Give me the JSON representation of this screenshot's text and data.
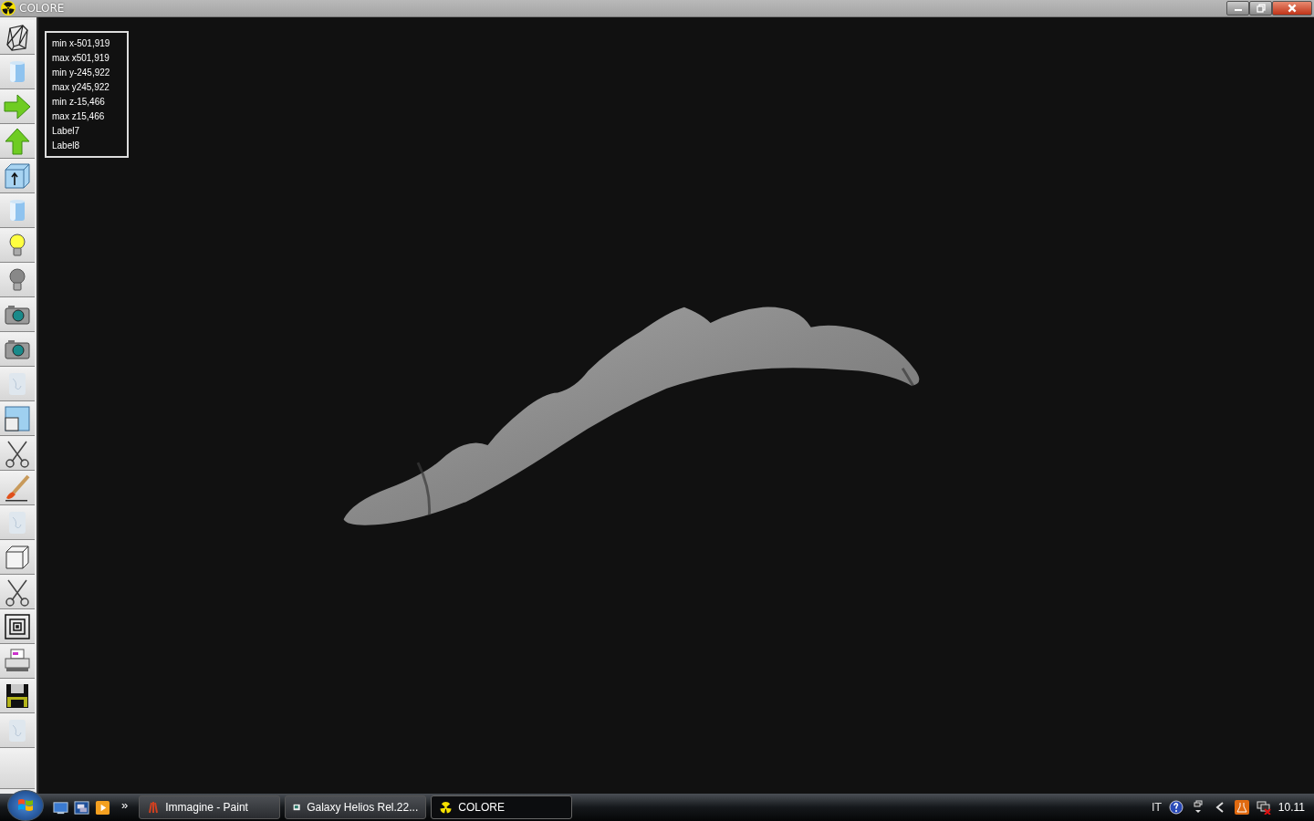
{
  "window": {
    "title": "COLORE"
  },
  "info_box": {
    "lines": [
      "min x-501,919",
      "max x501,919",
      "min y-245,922",
      "max y245,922",
      "min z-15,466",
      "max z15,466",
      "Label7",
      "Label8"
    ]
  },
  "taskbar": {
    "overflow": "»",
    "tasks": [
      {
        "label": "Immagine - Paint",
        "kind": "paint",
        "selected": false
      },
      {
        "label": "Galaxy Helios  Rel.22...",
        "kind": "document",
        "selected": false
      },
      {
        "label": "COLORE",
        "kind": "app",
        "selected": true
      }
    ],
    "language": "IT",
    "clock": "10.11"
  }
}
